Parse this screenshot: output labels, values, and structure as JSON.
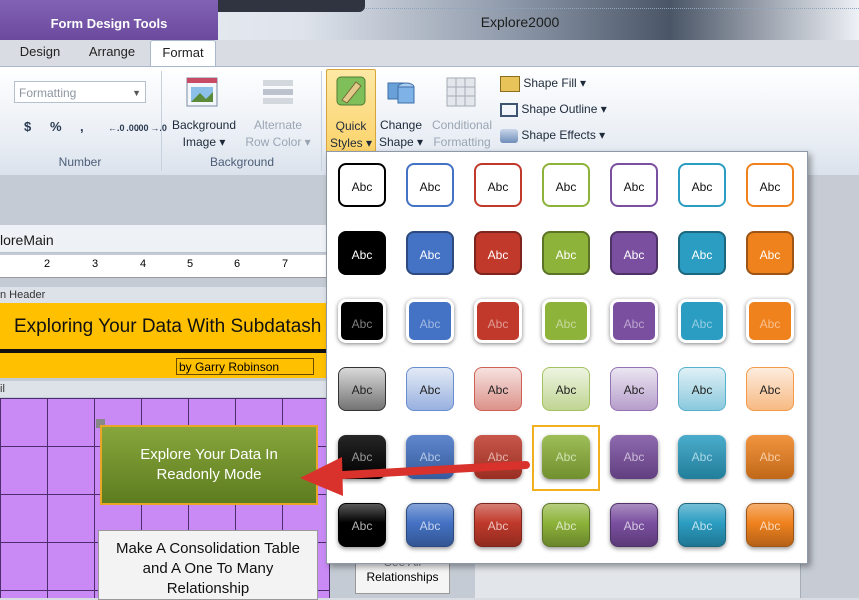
{
  "window": {
    "contextual_title": "Form Design Tools",
    "app_title": "Explore2000"
  },
  "tabs": [
    {
      "label": "Design"
    },
    {
      "label": "Arrange"
    },
    {
      "label": "Format"
    }
  ],
  "ribbon": {
    "number_group": {
      "format_placeholder": "Formatting",
      "currency": "$",
      "percent": "%",
      "comma": ",",
      "inc_decimal": "←.0 .00",
      "dec_decimal": ".00 →.0",
      "label": "Number"
    },
    "background_group": {
      "background_image_1": "Background",
      "background_image_2": "Image ▾",
      "alt_row_1": "Alternate",
      "alt_row_2": "Row Color ▾",
      "label": "Background"
    },
    "control_group": {
      "quick_styles_1": "Quick",
      "quick_styles_2": "Styles ▾",
      "change_shape_1": "Change",
      "change_shape_2": "Shape ▾",
      "conditional_1": "Conditional",
      "conditional_2": "Formatting",
      "shape_fill": "Shape Fill ▾",
      "shape_outline": "Shape Outline ▾",
      "shape_effects": "Shape Effects ▾"
    }
  },
  "document": {
    "tab_label": "loreMain",
    "ruler_numbers": [
      "2",
      "3",
      "4",
      "5",
      "6",
      "7"
    ],
    "header_section": "n Header",
    "header_title": "Exploring Your Data With Subdatash",
    "byline": "by Garry Robinson",
    "detail_section": "il",
    "explore_button_line1": "Explore Your Data In",
    "explore_button_line2": "Readonly Mode",
    "consolidation_line1": "Make A Consolidation Table",
    "consolidation_line2": "and A One To Many",
    "consolidation_line3": "Relationship",
    "relationships_line1": "See All",
    "relationships_line2": "Relationships"
  },
  "gallery": {
    "tile_label": "Abc",
    "theme_colors": [
      "#000000",
      "#4472c4",
      "#c0392b",
      "#8db33a",
      "#7a4fa0",
      "#2b9dc2",
      "#f0821e"
    ],
    "rows": [
      {
        "style": "outline"
      },
      {
        "style": "solid"
      },
      {
        "style": "white-border"
      },
      {
        "style": "pastel-gradient"
      },
      {
        "style": "intense"
      },
      {
        "style": "bevel"
      }
    ],
    "selected": {
      "row": 5,
      "col": 4
    }
  }
}
